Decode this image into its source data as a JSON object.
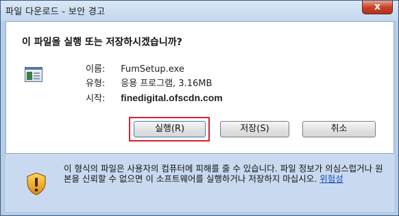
{
  "window": {
    "title": "파일 다운로드 - 보안 경고",
    "close_label": "x"
  },
  "dialog": {
    "question": "이 파일을 실행 또는 저장하시겠습니까?",
    "info": {
      "name_label": "이름:",
      "name_value": "FumSetup.exe",
      "type_label": "유형:",
      "type_value": "응용 프로그램, 3.16MB",
      "from_label": "시작:",
      "from_value": "finedigital.ofscdn.com"
    },
    "buttons": {
      "run": "실행(R)",
      "save": "저장(S)",
      "cancel": "취소"
    }
  },
  "warning": {
    "text": "이 형식의 파일은 사용자의 컴퓨터에 피해를 줄 수 있습니다. 파일 정보가 의심스럽거나 원본을 신뢰할 수 없으면 이 소프트웨어를 실행하거나 저장하지 마십시오. ",
    "link": "위험성"
  },
  "colors": {
    "accent": "#c5daf0",
    "link": "#1a4fb8",
    "focus_box": "#d4202a"
  },
  "icons": [
    "app-file-icon",
    "shield-warning-icon",
    "close-icon"
  ]
}
